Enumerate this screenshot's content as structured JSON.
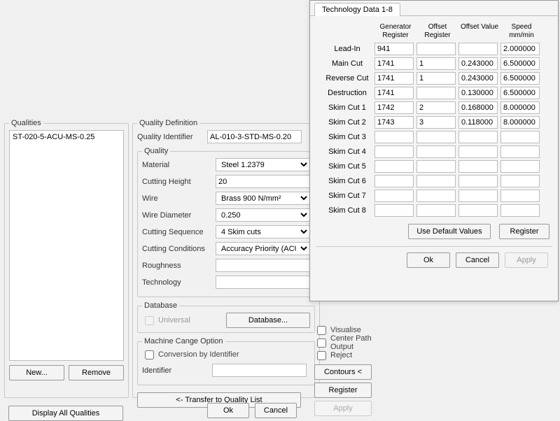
{
  "qualities": {
    "title": "Qualities",
    "items": [
      "ST-020-5-ACU-MS-0.25"
    ],
    "new_btn": "New...",
    "remove_btn": "Remove",
    "display_all": "Display All Qualities"
  },
  "qdef": {
    "title": "Quality Definition",
    "identifier_label": "Quality Identifier",
    "identifier_value": "AL-010-3-STD-MS-0.20",
    "quality_group": "Quality",
    "material_label": "Material",
    "material_value": "Steel 1.2379",
    "cutheight_label": "Cutting Height",
    "cutheight_value": "20",
    "wire_label": "Wire",
    "wire_value": "Brass 900 N/mm²",
    "wirediam_label": "Wire Diameter",
    "wirediam_value": "0.250",
    "cutseq_label": "Cutting Sequence",
    "cutseq_value": "4 Skim cuts",
    "cutcond_label": "Cutting Conditions",
    "cutcond_value": "Accuracy Priority (ACU)",
    "rough_label": "Roughness",
    "rough_value": "",
    "tech_label": "Technology",
    "tech_value": "",
    "database_group": "Database",
    "universal_label": "Universal",
    "database_btn": "Database...",
    "mco_group": "Machine Cange Option",
    "conv_label": "Conversion by Identifier",
    "ident_label": "Identifier",
    "ident_value": "",
    "transfer_btn": "<- Transfer to Quality List"
  },
  "main_ok": "Ok",
  "main_cancel": "Cancel",
  "checks": {
    "visualise": "Visualise",
    "centerpath": "Center Path Output",
    "reject": "Reject",
    "contours": "Contours <",
    "register": "Register",
    "apply": "Apply"
  },
  "techwin": {
    "tab": "Technology Data 1-8",
    "col1": "Generator Register",
    "col2": "Offset Register",
    "col3": "Offset Value",
    "col4": "Speed mm/min",
    "row_labels": [
      "Lead-In",
      "Main Cut",
      "Reverse Cut",
      "Destruction",
      "Skim Cut 1",
      "Skim Cut 2",
      "Skim Cut 3",
      "Skim Cut 4",
      "Skim Cut 5",
      "Skim Cut 6",
      "Skim Cut 7",
      "Skim Cut 8"
    ],
    "data": [
      [
        "941",
        "",
        "",
        "2.000000"
      ],
      [
        "1741",
        "1",
        "0.243000",
        "6.500000"
      ],
      [
        "1741",
        "1",
        "0.243000",
        "6.500000"
      ],
      [
        "1741",
        "",
        "0.130000",
        "6.500000"
      ],
      [
        "1742",
        "2",
        "0.168000",
        "8.000000"
      ],
      [
        "1743",
        "3",
        "0.118000",
        "8.000000"
      ],
      [
        "",
        "",
        "",
        ""
      ],
      [
        "",
        "",
        "",
        ""
      ],
      [
        "",
        "",
        "",
        ""
      ],
      [
        "",
        "",
        "",
        ""
      ],
      [
        "",
        "",
        "",
        ""
      ],
      [
        "",
        "",
        "",
        ""
      ]
    ],
    "default_btn": "Use Default Values",
    "register_btn": "Register",
    "ok": "Ok",
    "cancel": "Cancel",
    "apply": "Apply"
  }
}
